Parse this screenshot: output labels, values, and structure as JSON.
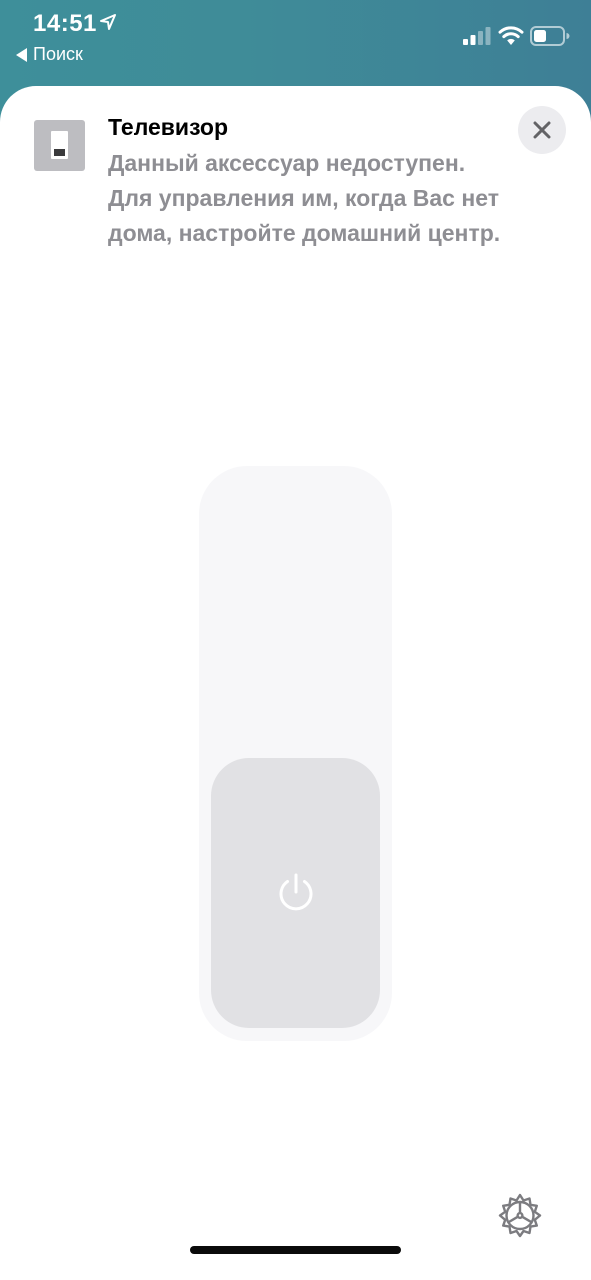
{
  "status_bar": {
    "time": "14:51",
    "back_label": "Поиск",
    "icons": {
      "location": "location-arrow-icon",
      "signal": "cellular-signal-icon",
      "wifi": "wifi-icon",
      "battery": "battery-icon"
    }
  },
  "accessory": {
    "icon": "light-switch-icon",
    "name": "Телевизор",
    "status_message": "Данный аксессуар недоступен. Для управления им, когда Вас нет дома, настройте домашний центр.",
    "power_on": false
  },
  "controls": {
    "close_icon": "close-icon",
    "power_icon": "power-icon",
    "settings_icon": "gear-icon"
  },
  "colors": {
    "header_background": "#3e8f9a",
    "secondary_text": "#8e8e93",
    "switch_track": "#f7f7f9",
    "switch_knob": "#e1e1e4"
  }
}
